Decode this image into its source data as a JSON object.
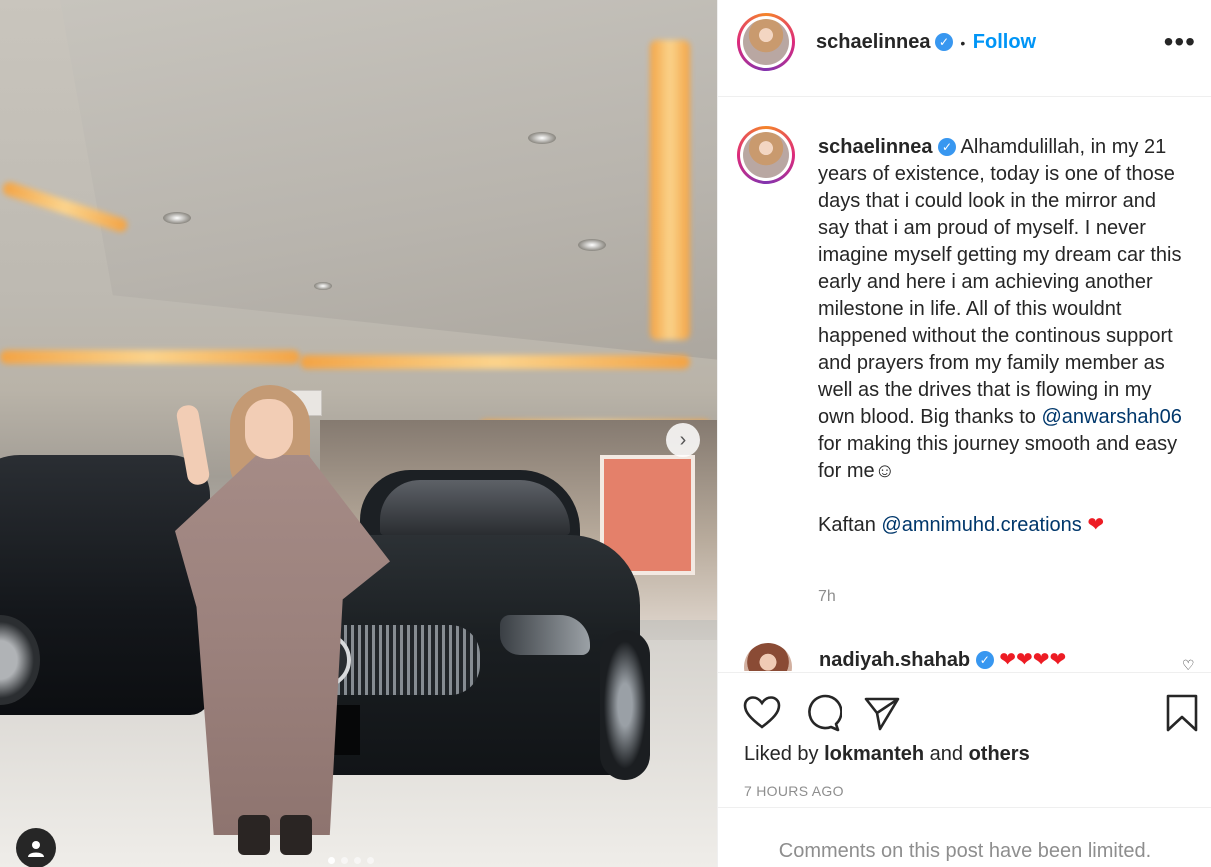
{
  "post": {
    "username": "schaelinnea",
    "verified_mark": "✓",
    "separator": "•",
    "follow_label": "Follow",
    "more_label": "•••",
    "caption_parts": {
      "intro": " Alhamdulillah, in my 21 years of existence, today is one of those days that i could look in the mirror and say that i am proud of myself. I never imagine myself getting my dream car this early and here i am achieving another milestone in life. All of this wouldnt happened without the continous support and prayers from my family member as well as the drives that is flowing in my own blood. Big thanks to ",
      "mention_1": "@anwarshah06",
      "after_mention": " for making this journey smooth and easy for me☺",
      "kaftan_label": "Kaftan ",
      "mention_2": "@amnimuhd.creations",
      "heart": "❤"
    },
    "caption_time": "7h"
  },
  "comment": {
    "username": "nadiyah.shahab",
    "text": "❤❤❤❤",
    "like_icon": "♡"
  },
  "actions": {
    "liked_by_prefix": "Liked by ",
    "liked_by_user": "lokmanteh",
    "liked_by_middle": " and ",
    "liked_by_others": "others",
    "timestamp": "7 HOURS AGO",
    "comments_limited": "Comments on this post have been limited."
  },
  "media": {
    "next_arrow": "›",
    "carousel_count": 4,
    "active_index": 0
  },
  "colors": {
    "accent": "#0095f6",
    "verified": "#3897f0",
    "heart": "#ed1c24",
    "muted": "#8e8e8e"
  },
  "icons": [
    "heart-icon",
    "comment-icon",
    "share-icon",
    "bookmark-icon",
    "user-tag-icon",
    "next-arrow-icon"
  ]
}
